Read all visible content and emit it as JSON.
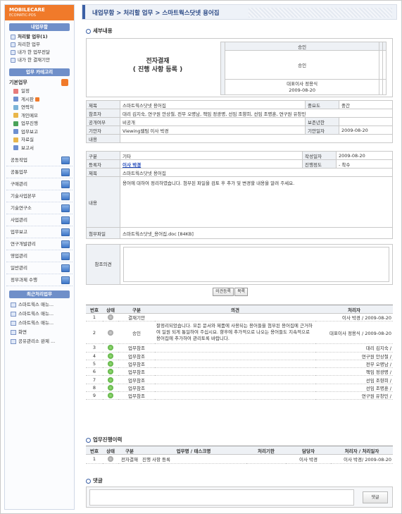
{
  "logo": {
    "title": "MOBILECARE",
    "subtitle": "ECOMATIC-POS"
  },
  "sidebar": {
    "section_title": "내업무함",
    "items": [
      {
        "label": "처리할 업무(1)",
        "bold": true
      },
      {
        "label": "처리한 업무",
        "bold": false
      },
      {
        "label": "내가 한 업무전달",
        "bold": false
      },
      {
        "label": "내가 한 결재기안",
        "bold": false
      }
    ],
    "category_title": "업무 카테고리",
    "group_head": "기본업무",
    "group_items": [
      {
        "label": "일정",
        "color": "#e77b7b"
      },
      {
        "label": "게시판",
        "color": "#6d8fd0",
        "new": true
      },
      {
        "label": "연락처",
        "color": "#7bb3d8"
      },
      {
        "label": "개인메모",
        "color": "#e9b64a"
      },
      {
        "label": "업무진행",
        "color": "#4aa35a"
      },
      {
        "label": "업무보고",
        "color": "#6d8fd0"
      },
      {
        "label": "자료실",
        "color": "#e9b64a"
      },
      {
        "label": "보고서",
        "color": "#6d8fd0"
      }
    ],
    "categories": [
      "공동작업",
      "공통업무",
      "구매관리",
      "기술사업본부",
      "기술연구소",
      "사업관리",
      "업무보고",
      "연구개발관리",
      "영업관리",
      "일반관리",
      "정부과제 수행"
    ],
    "recent_title": "최근처리업무",
    "recent": [
      "스마트웍스 매뉴...",
      "스마트웍스 매뉴...",
      "스마트웍스 매뉴...",
      "화면",
      "공유관리소 완제 ..."
    ]
  },
  "header": {
    "breadcrumb": "내업무함 > 처리할 업무 > 스마트웍스닷넷 용어집"
  },
  "detail": {
    "section": "세부내용",
    "doc_title_1": "전자결재",
    "doc_title_2": "( 진행 사항 등록 )",
    "approval_head": "승인",
    "approval_cell": "승인",
    "approver": "대표이사 정용식",
    "approval_date": "2009-08-20"
  },
  "info": {
    "title_label": "제목",
    "title_value": "스마트웍스닷넷 용어집",
    "importance_label": "중요도",
    "importance_value": "중간",
    "ref_label": "참조자",
    "ref_value": "대리 김지숙, 연구원 안상철, 전무 오명남, 책임 정광명, 선임 조향희, 선임 조명훈, 연구원 유창민",
    "public_label": "공개여부",
    "public_value": "비공개",
    "keep_label": "보존년한",
    "keep_value": "",
    "drafter_label": "기안자",
    "drafter_value": "Viewing웹팀 이사 박경",
    "draft_date_label": "기안일자",
    "draft_date_value": "2009-08-20",
    "content_label": "내용"
  },
  "info2": {
    "type_label": "구분",
    "type_value": "기타",
    "write_date_label": "작성일자",
    "write_date_value": "2009-08-20",
    "writer_label": "등록자",
    "writer_value": "이사 박경",
    "progress_label": "진행정도",
    "progress_value": "- 착수",
    "subject_label": "제목",
    "subject_value": "스마트웍스닷넷 용어집",
    "body_label": "내용",
    "body_value": "용어에 대하여 정리하였습니다.  첨부된 파일을 검토 후 추가 및 변경할 내용을 알려 주세요.",
    "attach_label": "첨부파일",
    "attach_value": "스마트웍스닷넷_용어집.doc [84KB]"
  },
  "opinion": {
    "label": "참조의견"
  },
  "buttons": {
    "opinion_register": "의견등록",
    "list": "목록"
  },
  "history": {
    "columns": [
      "번호",
      "상태",
      "구분",
      "의견",
      "처리자"
    ],
    "rows": [
      {
        "no": "1",
        "status": "done",
        "type": "결재기안",
        "opinion": "",
        "handler": "이사 박경 / 2009-08-20"
      },
      {
        "no": "2",
        "status": "done",
        "type": "승인",
        "opinion": "잘정리되었습니다. 모든 문서와 제품에 사용되는 용어들을 첨부된 용어집에 근거하여 일원 되게 통일하여 주십시요. 향후에 추가적으로 나오는 용어들도 지속적으로 용어집에 추가하여 관리토록 바랍니다.",
        "handler": "대표이사 정용식 / 2009-08-20"
      },
      {
        "no": "3",
        "status": "go",
        "type": "업무참조",
        "opinion": "",
        "handler": "대리 김지숙 /"
      },
      {
        "no": "4",
        "status": "go",
        "type": "업무참조",
        "opinion": "",
        "handler": "연구원 안상철 /"
      },
      {
        "no": "5",
        "status": "go",
        "type": "업무참조",
        "opinion": "",
        "handler": "전무 오명남 /"
      },
      {
        "no": "6",
        "status": "go",
        "type": "업무참조",
        "opinion": "",
        "handler": "책임 정광명 /"
      },
      {
        "no": "7",
        "status": "go",
        "type": "업무참조",
        "opinion": "",
        "handler": "선임 조향희 /"
      },
      {
        "no": "8",
        "status": "go",
        "type": "업무참조",
        "opinion": "",
        "handler": "선임 조명훈 /"
      },
      {
        "no": "9",
        "status": "go",
        "type": "업무참조",
        "opinion": "",
        "handler": "연구원 유창민 /"
      }
    ]
  },
  "progress": {
    "section": "업무진행이력",
    "columns": [
      "번호",
      "상태",
      "구분",
      "업무명 / 태스크명",
      "처리기한",
      "담당자",
      "처리자 / 처리일자"
    ],
    "rows": [
      {
        "no": "1",
        "type": "전자결재",
        "name": "진행 사항 등록",
        "deadline": "",
        "owner": "이사 박경",
        "handler": "이사 박경/ 2009-08-20"
      }
    ]
  },
  "comment": {
    "section": "댓글",
    "button": "댓글"
  }
}
